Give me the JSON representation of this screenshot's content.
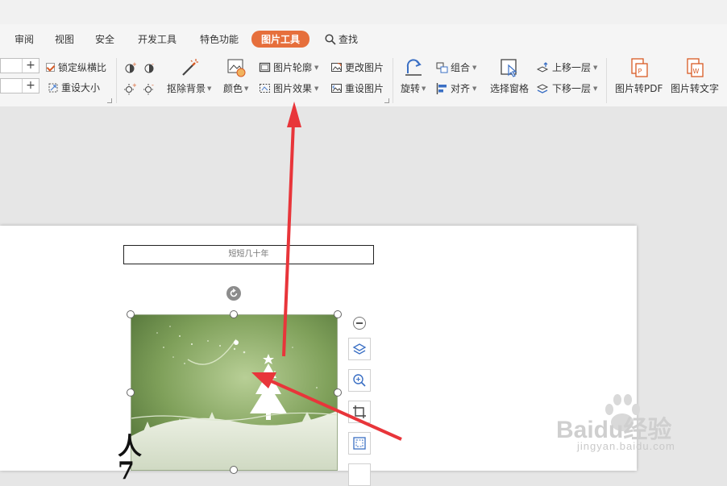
{
  "menu_tabs": [
    {
      "label": "审阅"
    },
    {
      "label": "视图"
    },
    {
      "label": "安全"
    },
    {
      "label": "开发工具"
    },
    {
      "label": "特色功能"
    },
    {
      "label": "图片工具",
      "active": true
    },
    {
      "label": "查找",
      "icon": "search-icon"
    }
  ],
  "ribbon": {
    "size": {
      "lock_ratio_label": "锁定纵横比",
      "lock_ratio_checked": true,
      "reset_size_label": "重设大小"
    },
    "remove_background_label": "抠除背景",
    "color_label": "颜色",
    "picture_outline_label": "图片轮廓",
    "picture_effect_label": "图片效果",
    "change_picture_label": "更改图片",
    "reset_picture_label": "重设图片",
    "rotate_label": "旋转",
    "group_label": "组合",
    "align_label": "对齐",
    "selection_pane_label": "选择窗格",
    "bring_forward_label": "上移一层",
    "send_backward_label": "下移一层",
    "to_pdf_label": "图片转PDF",
    "to_text_label": "图片转文字"
  },
  "document": {
    "header_text": "短短几十年",
    "body_glyphs": "人\n7"
  },
  "watermark": {
    "brand": "Baidu经验",
    "url": "jingyan.baidu.com"
  },
  "colors": {
    "accent": "#e66f3c",
    "arrow": "#e8353a",
    "page": "#ffffff",
    "canvas": "#e6e6e6"
  }
}
